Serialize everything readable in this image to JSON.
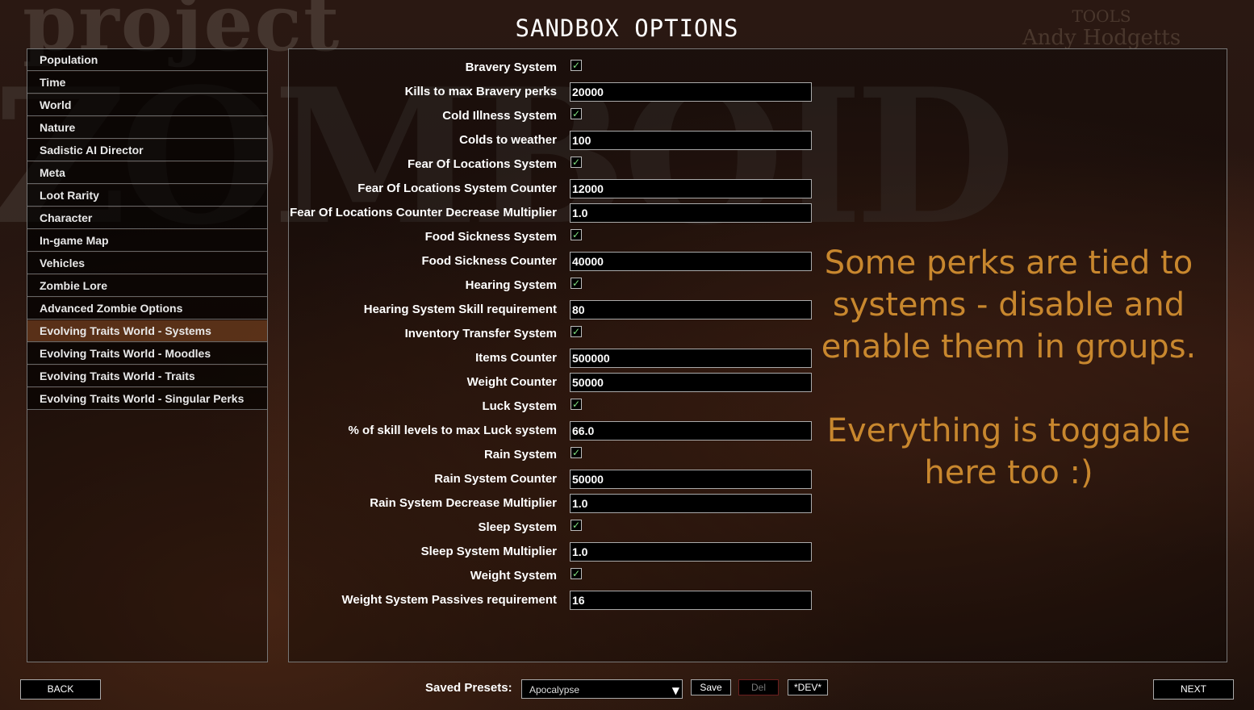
{
  "background": {
    "logo_top": "project",
    "logo_big": "ZOMBOID",
    "credit_title": "TOOLS",
    "credit_name": "Andy Hodgetts"
  },
  "title": "SANDBOX OPTIONS",
  "sidebar": {
    "items": [
      {
        "label": "Population"
      },
      {
        "label": "Time"
      },
      {
        "label": "World"
      },
      {
        "label": "Nature"
      },
      {
        "label": "Sadistic AI Director"
      },
      {
        "label": "Meta"
      },
      {
        "label": "Loot Rarity"
      },
      {
        "label": "Character"
      },
      {
        "label": "In-game Map"
      },
      {
        "label": "Vehicles"
      },
      {
        "label": "Zombie Lore"
      },
      {
        "label": "Advanced Zombie Options"
      },
      {
        "label": "Evolving Traits World - Systems"
      },
      {
        "label": "Evolving Traits World - Moodles"
      },
      {
        "label": "Evolving Traits World - Traits"
      },
      {
        "label": "Evolving Traits World - Singular Perks"
      }
    ],
    "active_index": 12
  },
  "options": [
    {
      "label": "Bravery System",
      "type": "checkbox",
      "checked": true
    },
    {
      "label": "Kills to max Bravery perks",
      "type": "text",
      "value": "20000"
    },
    {
      "label": "Cold Illness System",
      "type": "checkbox",
      "checked": true
    },
    {
      "label": "Colds to weather",
      "type": "text",
      "value": "100"
    },
    {
      "label": "Fear Of Locations System",
      "type": "checkbox",
      "checked": true
    },
    {
      "label": "Fear Of Locations System Counter",
      "type": "text",
      "value": "12000"
    },
    {
      "label": "Fear Of Locations Counter Decrease Multiplier",
      "type": "text",
      "value": "1.0"
    },
    {
      "label": "Food Sickness System",
      "type": "checkbox",
      "checked": true
    },
    {
      "label": "Food Sickness Counter",
      "type": "text",
      "value": "40000"
    },
    {
      "label": "Hearing System",
      "type": "checkbox",
      "checked": true
    },
    {
      "label": "Hearing System Skill requirement",
      "type": "text",
      "value": "80"
    },
    {
      "label": "Inventory Transfer System",
      "type": "checkbox",
      "checked": true
    },
    {
      "label": "Items Counter",
      "type": "text",
      "value": "500000"
    },
    {
      "label": "Weight Counter",
      "type": "text",
      "value": "50000"
    },
    {
      "label": "Luck System",
      "type": "checkbox",
      "checked": true
    },
    {
      "label": "% of skill levels to max Luck system",
      "type": "text",
      "value": "66.0"
    },
    {
      "label": "Rain System",
      "type": "checkbox",
      "checked": true
    },
    {
      "label": "Rain System Counter",
      "type": "text",
      "value": "50000"
    },
    {
      "label": "Rain System Decrease Multiplier",
      "type": "text",
      "value": "1.0"
    },
    {
      "label": "Sleep System",
      "type": "checkbox",
      "checked": true
    },
    {
      "label": "Sleep System Multiplier",
      "type": "text",
      "value": "1.0"
    },
    {
      "label": "Weight System",
      "type": "checkbox",
      "checked": true
    },
    {
      "label": "Weight System Passives requirement",
      "type": "text",
      "value": "16"
    }
  ],
  "checkmark_glyph": "✓",
  "hint": {
    "line1": "Some perks are tied to",
    "line2": "systems - disable and",
    "line3": "enable them in groups.",
    "line4": "Everything is toggable",
    "line5": "here too :)"
  },
  "hint_color": "#c8872e",
  "footer": {
    "back_label": "BACK",
    "presets_label": "Saved Presets:",
    "preset_selected": "Apocalypse",
    "save_label": "Save",
    "del_label": "Del",
    "dev_label": "*DEV*",
    "next_label": "NEXT",
    "dropdown_arrow": "▼"
  }
}
